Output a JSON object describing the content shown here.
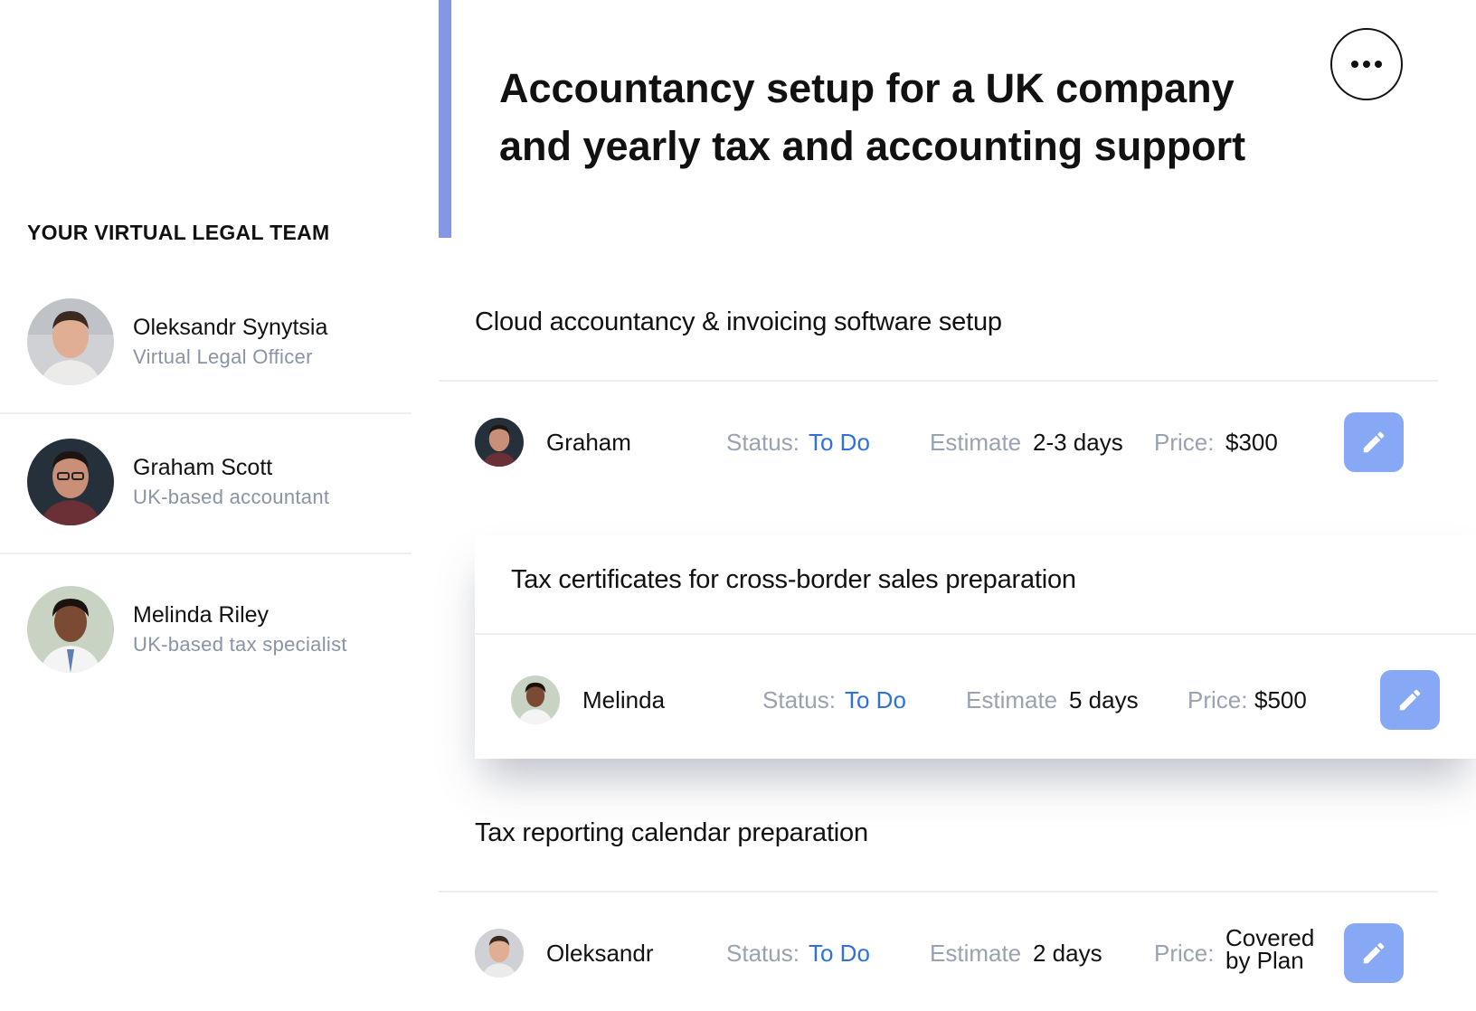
{
  "header": {
    "title": "Accountancy setup for a UK company and yearly tax and accounting support",
    "accent_color": "#8696e6",
    "more_icon": "more-horizontal-icon"
  },
  "sidebar": {
    "heading": "YOUR VIRTUAL LEGAL TEAM",
    "members": [
      {
        "name": "Oleksandr Synytsia",
        "role": "Virtual Legal Officer"
      },
      {
        "name": "Graham Scott",
        "role": "UK-based accountant"
      },
      {
        "name": "Melinda Riley",
        "role": "UK-based tax specialist"
      }
    ]
  },
  "tasks": [
    {
      "title": "Cloud accountancy & invoicing software setup",
      "assignee": "Graham",
      "status_label": "Status:",
      "status": "To Do",
      "estimate_label": "Estimate",
      "estimate": "2-3 days",
      "price_label": "Price:",
      "price": "$300"
    },
    {
      "title": "Tax certificates for cross-border sales preparation",
      "assignee": "Melinda",
      "status_label": "Status:",
      "status": "To Do",
      "estimate_label": "Estimate",
      "estimate": "5 days",
      "price_label": "Price:",
      "price": "$500"
    },
    {
      "title": "Tax reporting calendar preparation",
      "assignee": "Oleksandr",
      "status_label": "Status:",
      "status": "To Do",
      "estimate_label": "Estimate",
      "estimate": "2 days",
      "price_label": "Price:",
      "price": "Covered by Plan"
    }
  ],
  "colors": {
    "status_blue": "#2f6fe0",
    "edit_button": "#87a9f5",
    "muted_text": "#9aa1b1"
  },
  "icons": {
    "edit": "pencil-icon",
    "avatar": "person-avatar"
  }
}
